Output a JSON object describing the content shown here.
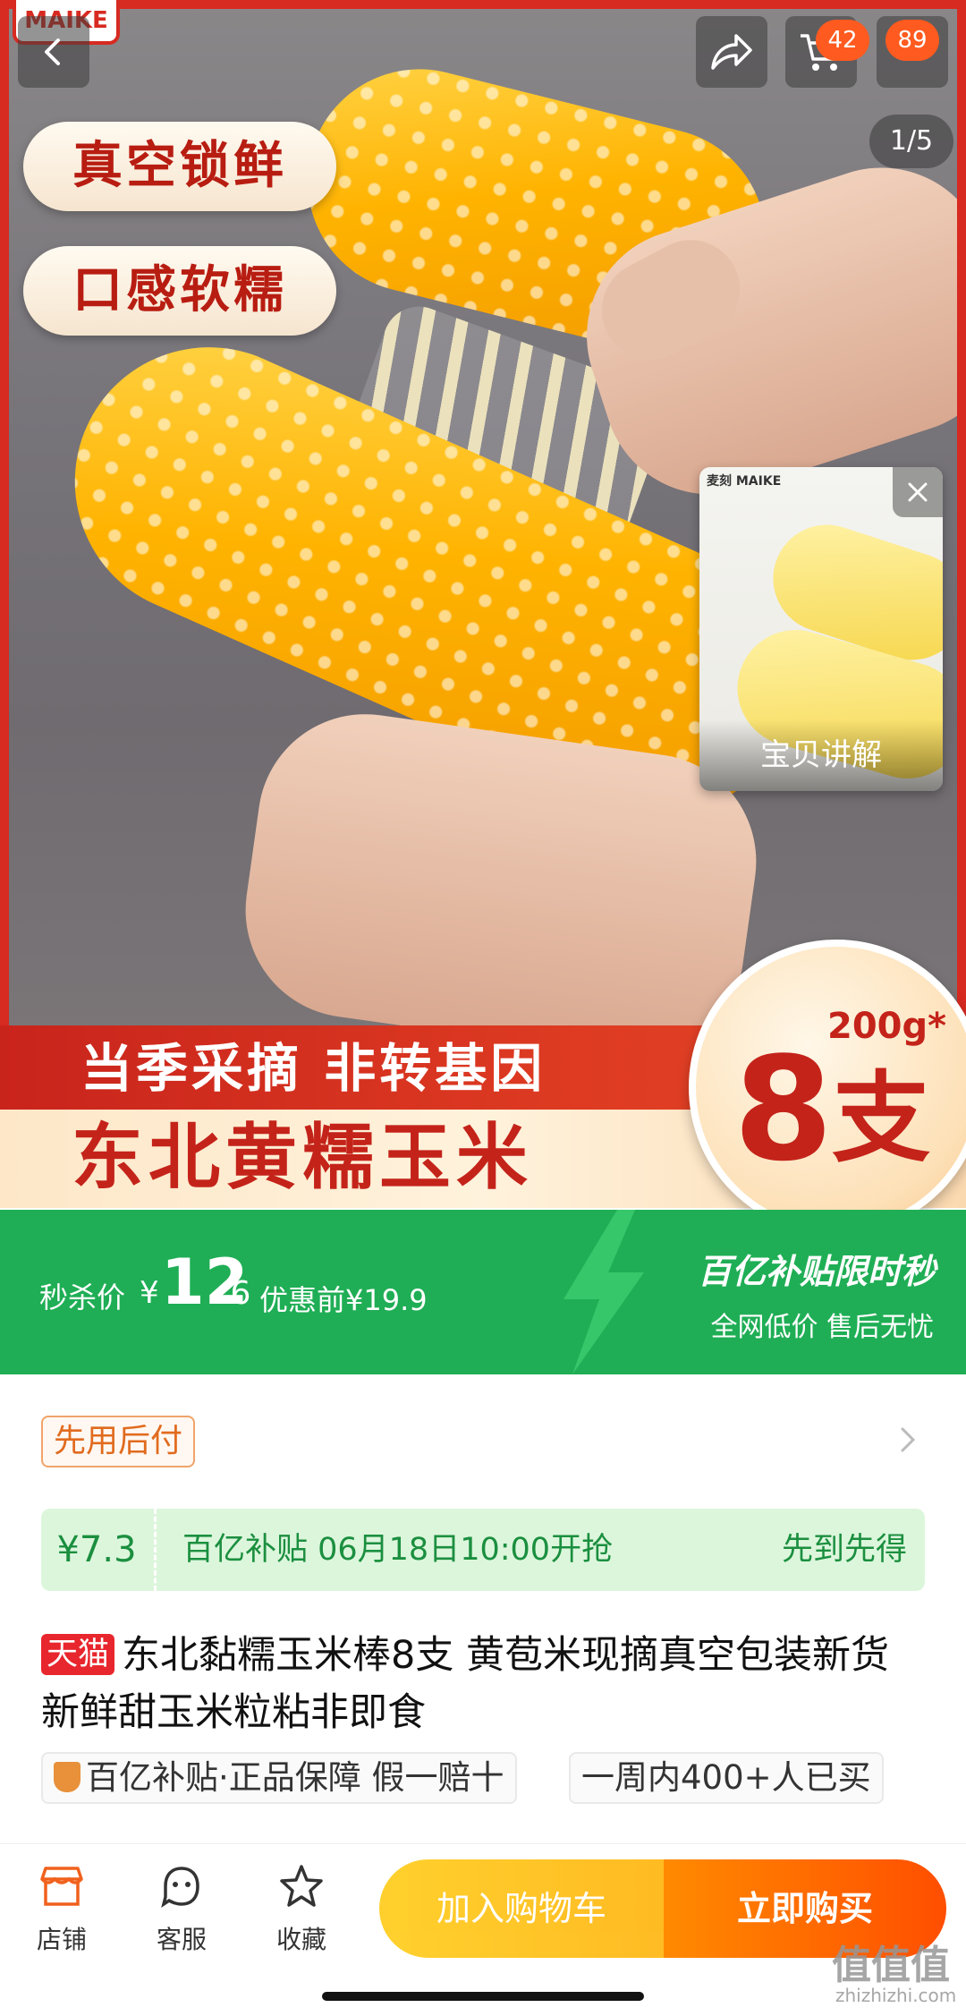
{
  "hero": {
    "brand_logo": "MAIKE",
    "tags": [
      "真空锁鲜",
      "口感软糯"
    ],
    "image_counter": "1/5",
    "promo_line_1": "当季采摘 非转基因",
    "promo_line_2": "东北黄糯玉米",
    "count_weight": "200g*",
    "count_number": "8",
    "count_unit": "支"
  },
  "nav": {
    "cart_badge": "42",
    "more_badge": "89"
  },
  "video_card": {
    "logo_text": "麦刻 MAIKE",
    "label": "宝贝讲解"
  },
  "price_bar": {
    "label": "秒杀价",
    "currency": "¥",
    "price_int": "12",
    "price_dec": ".6",
    "original": "优惠前¥19.9",
    "campaign_title": "百亿补贴限时秒",
    "campaign_desc": "全网低价 售后无忧"
  },
  "pay_later": "先用后付",
  "subsidy": {
    "price": "¥7.3",
    "text": "百亿补贴 06月18日10:00开抢",
    "right": "先到先得"
  },
  "title": {
    "tag": "天猫",
    "text": "东北黏糯玉米棒8支 黄苞米现摘真空包装新货新鲜甜玉米粒粘非即食"
  },
  "chips": {
    "guarantee": "百亿补贴·正品保障 假一赔十",
    "sales": "一周内400+人已买"
  },
  "bottom": {
    "shop": "店铺",
    "service": "客服",
    "favorite": "收藏",
    "add_cart": "加入购物车",
    "buy_now": "立即购买"
  },
  "watermark": {
    "text": "值值值",
    "url": "zhizhizhi.com"
  },
  "colors": {
    "brand_red": "#d72a21",
    "green_bar": "#1fae55",
    "buy_orange": "#ff4e00",
    "cart_yellow": "#ffb40b"
  }
}
